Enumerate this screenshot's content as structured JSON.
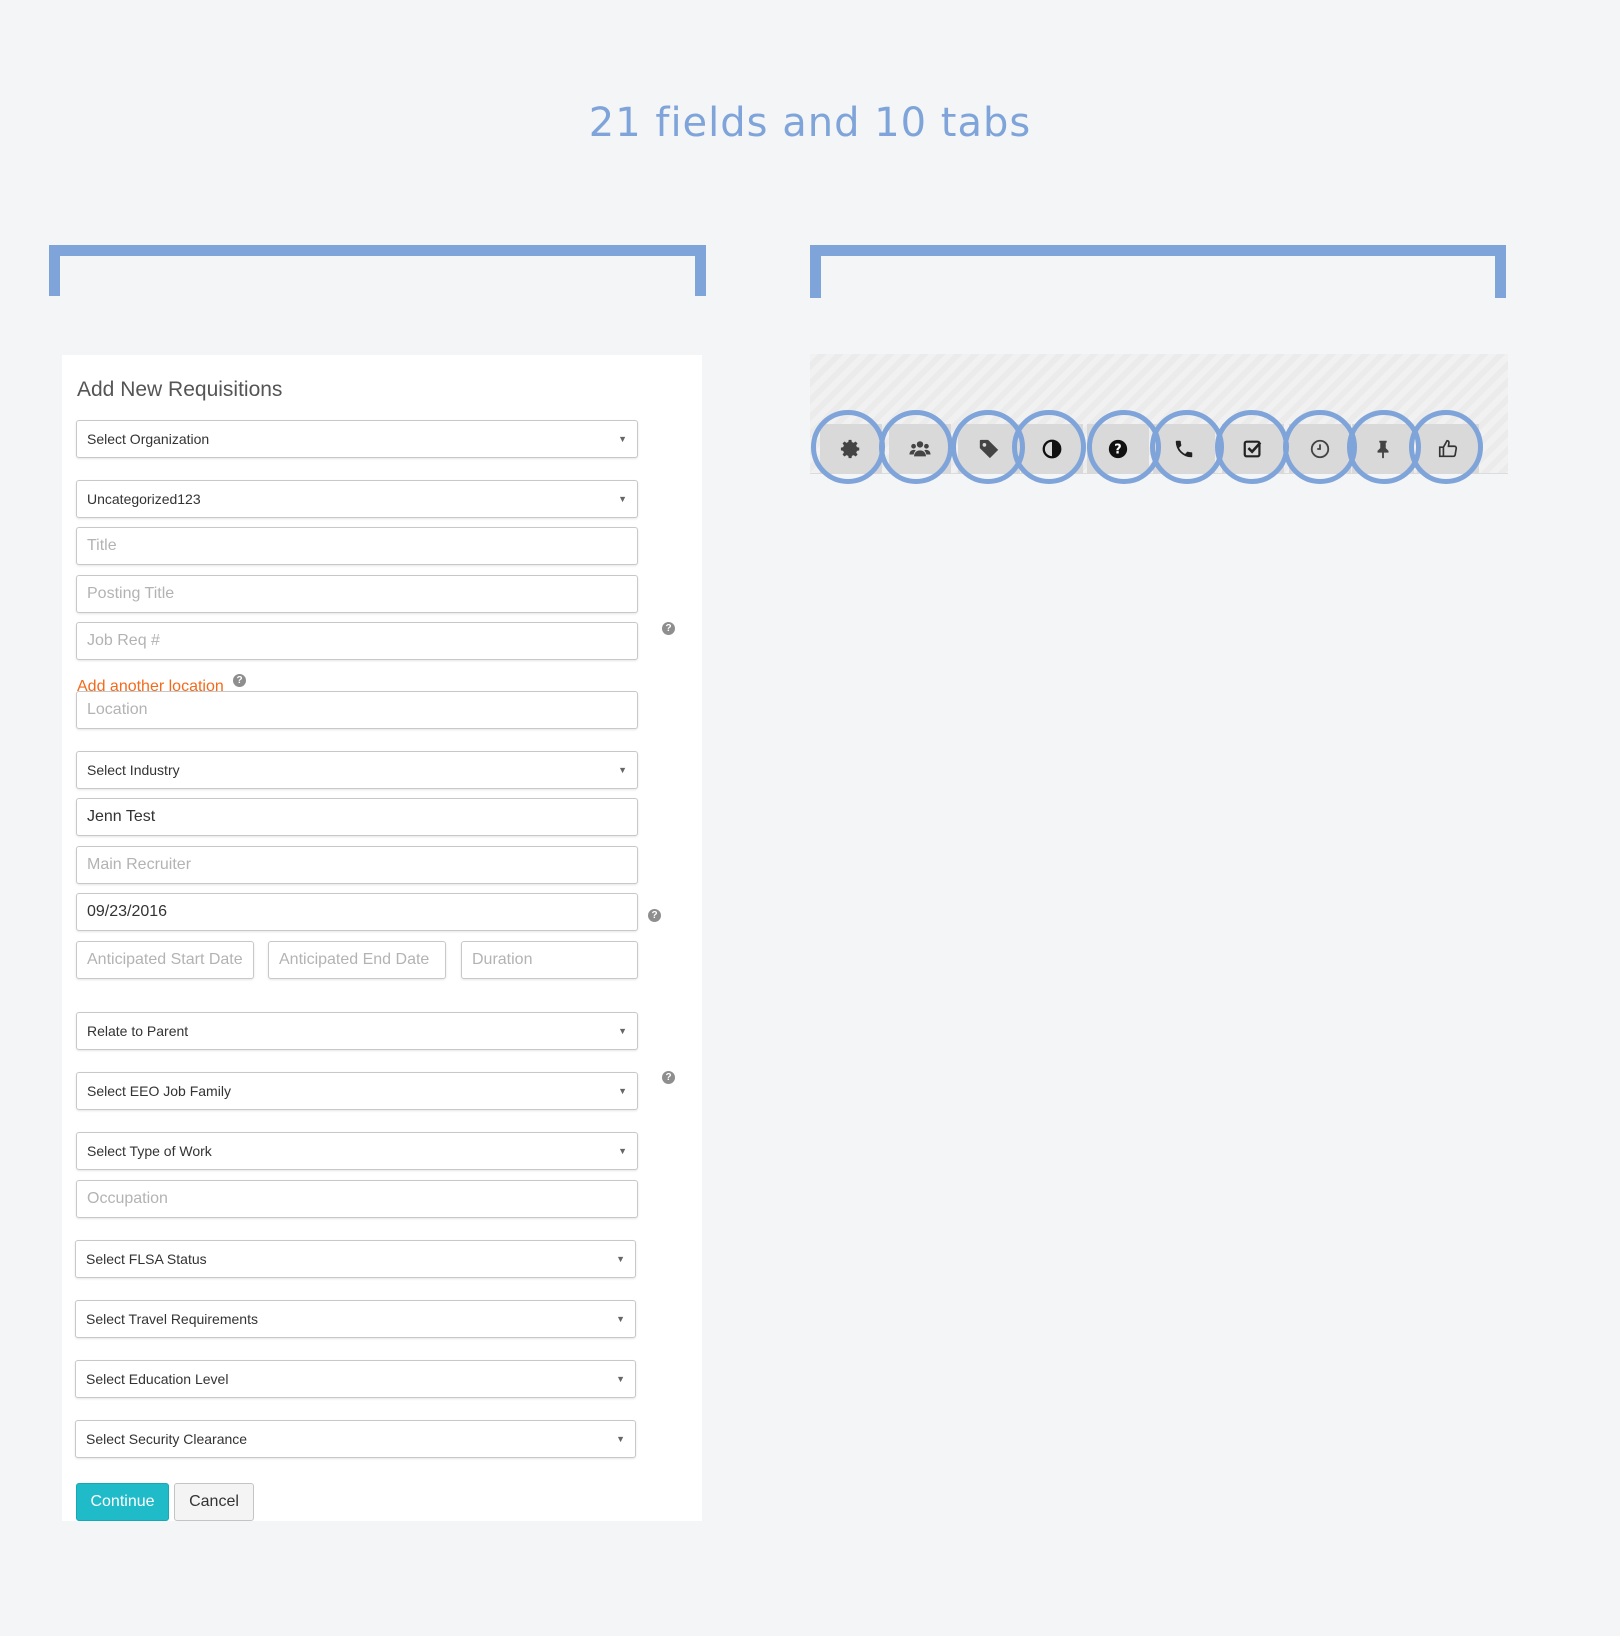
{
  "headline": "21 fields and 10 tabs",
  "form": {
    "title": "Add New Requisitions",
    "organization": "Select Organization",
    "category": "Uncategorized123",
    "title_placeholder": "Title",
    "posting_title_placeholder": "Posting Title",
    "job_req_placeholder": "Job Req #",
    "add_location_link": "Add another location",
    "location_placeholder": "Location",
    "industry": "Select Industry",
    "hiring_manager_value": "Jenn Test",
    "main_recruiter_placeholder": "Main Recruiter",
    "date_value": "09/23/2016",
    "start_date_placeholder": "Anticipated Start Date",
    "end_date_placeholder": "Anticipated End Date",
    "duration_placeholder": "Duration",
    "relate_parent": "Relate to Parent",
    "eeo_job_family": "Select EEO Job Family",
    "type_of_work": "Select Type of Work",
    "occupation_placeholder": "Occupation",
    "flsa_status": "Select FLSA Status",
    "travel_requirements": "Select Travel Requirements",
    "education_level": "Select Education Level",
    "security_clearance": "Select Security Clearance",
    "continue_label": "Continue",
    "cancel_label": "Cancel"
  },
  "tabs": [
    {
      "icon": "gear-icon"
    },
    {
      "icon": "users-icon"
    },
    {
      "icon": "tag-icon"
    },
    {
      "icon": "contrast-icon"
    },
    {
      "icon": "question-icon"
    },
    {
      "icon": "phone-icon"
    },
    {
      "icon": "checkbox-icon"
    },
    {
      "icon": "clock-icon"
    },
    {
      "icon": "pin-icon"
    },
    {
      "icon": "thumbs-up-icon"
    }
  ],
  "colors": {
    "accent": "#7fa4d9",
    "link": "#f26b1d",
    "primary_button": "#1fbbc9"
  }
}
